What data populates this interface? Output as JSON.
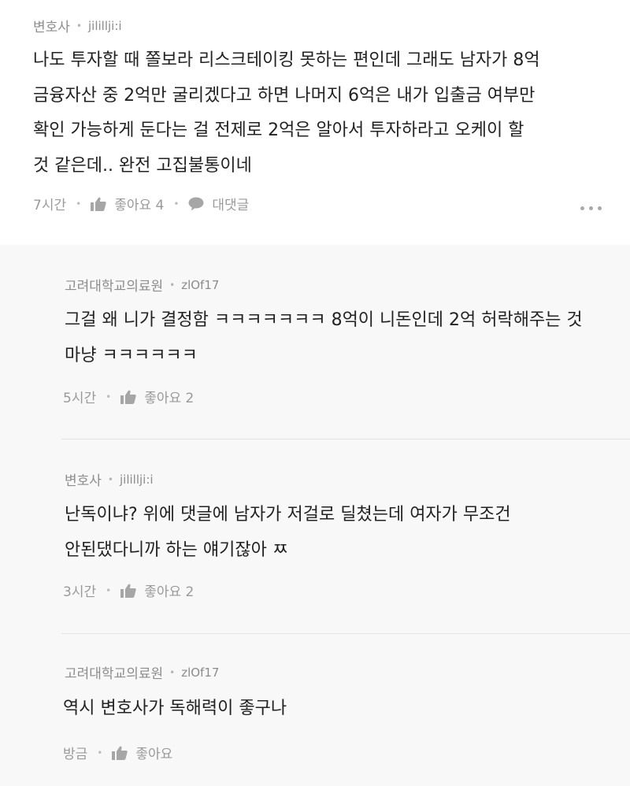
{
  "comments": [
    {
      "author": "변호사",
      "user_id": "jilillji:i",
      "text": "나도 투자할 때 쫄보라 리스크테이킹 못하는 편인데 그래도 남자가 8억\n금융자산 중 2억만 굴리겠다고 하면 나머지 6억은 내가 입출금 여부만\n확인 가능하게 둔다는 걸 전제로 2억은 알아서 투자하라고 오케이 할\n것 같은데.. 완전 고집불통이네",
      "time": "7시간",
      "like_label": "좋아요 4",
      "reply_label": "대댓글"
    },
    {
      "author": "고려대학교의료원",
      "user_id": "zlOf17",
      "text": "그걸 왜 니가 결정함 ㅋㅋㅋㅋㅋㅋㅋ 8억이 니돈인데 2억 허락해주는 것\n마냥 ㅋㅋㅋㅋㅋㅋ",
      "time": "5시간",
      "like_label": "좋아요 2"
    },
    {
      "author": "변호사",
      "user_id": "jilillji:i",
      "text": "난독이냐? 위에 댓글에 남자가 저걸로 딜쳤는데 여자가 무조건\n안된댔다니까 하는 얘기잖아 ㅉ",
      "time": "3시간",
      "like_label": "좋아요 2"
    },
    {
      "author": "고려대학교의료원",
      "user_id": "zlOf17",
      "text": "역시 변호사가 독해력이 좋구나",
      "time": "방금",
      "like_label": "좋아요"
    }
  ],
  "icons": {
    "like": "thumbs-up-icon",
    "reply": "speech-bubble-icon",
    "more": "more-dots-icon"
  },
  "colors": {
    "top_background": "#ffffff",
    "reply_background": "#f8f8f8",
    "text": "#222222",
    "meta": "#9a9a9a"
  }
}
